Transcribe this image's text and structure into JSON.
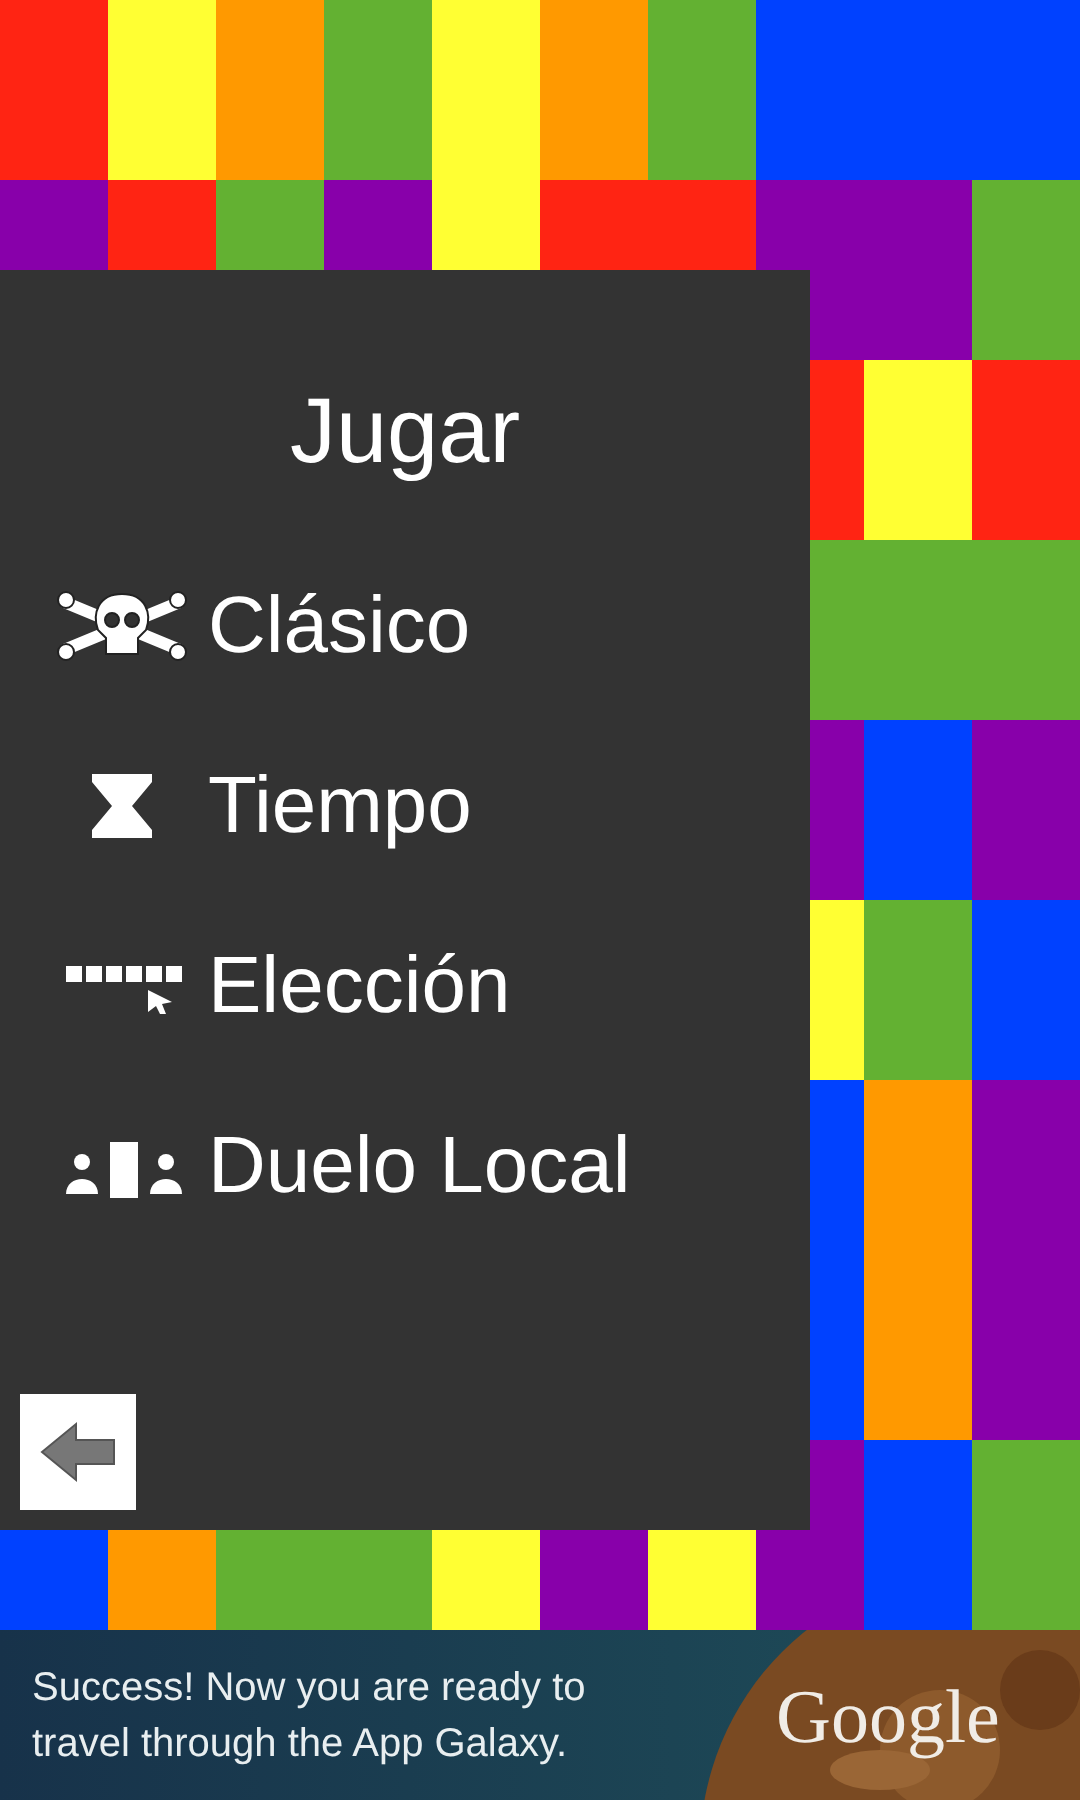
{
  "menu": {
    "title": "Jugar",
    "items": [
      {
        "label": "Clásico",
        "kind": "skull"
      },
      {
        "label": "Tiempo",
        "kind": "hourglass"
      },
      {
        "label": "Elección",
        "kind": "pick"
      },
      {
        "label": "Duelo Local",
        "kind": "duel"
      }
    ]
  },
  "ad_banner": {
    "text": "Success! Now you are ready to travel through the App Galaxy.",
    "brand": "Google"
  }
}
